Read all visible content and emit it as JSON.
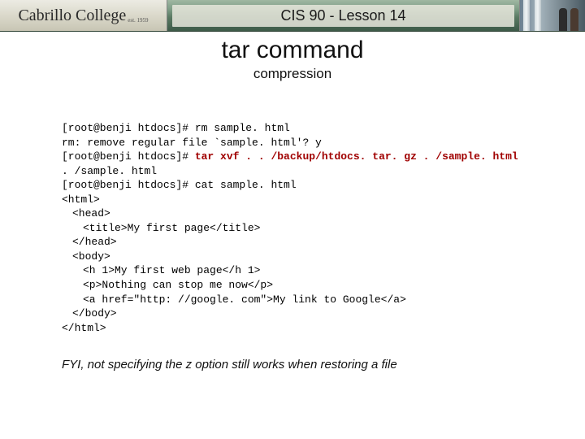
{
  "header": {
    "logo_text": "Cabrillo College",
    "logo_sub": "est. 1959",
    "lesson": "CIS 90 - Lesson 14"
  },
  "title": {
    "main": "tar command",
    "sub": "compression"
  },
  "term": {
    "l1a": "[root@benji htdocs]# ",
    "l1b": "rm sample. html",
    "l2": "rm: remove regular file `sample. html'? y",
    "l3a": "[root@benji htdocs]# ",
    "l3b": "tar xvf . . /backup/htdocs. tar. gz . /sample. html",
    "l4": ". /sample. html",
    "l5": "[root@benji htdocs]# cat sample. html",
    "l6": "<html>",
    "l7": "<head>",
    "l8": "<title>My first page</title>",
    "l9": "</head>",
    "l10": "<body>",
    "l11": "<h 1>My first web page</h 1>",
    "l12": "<p>Nothing can stop me now</p>",
    "l13": "<a href=\"http: //google. com\">My link to Google</a>",
    "l14": "</body>",
    "l15": "</html>"
  },
  "footnote": "FYI, not specifying the z option still works when restoring a file"
}
